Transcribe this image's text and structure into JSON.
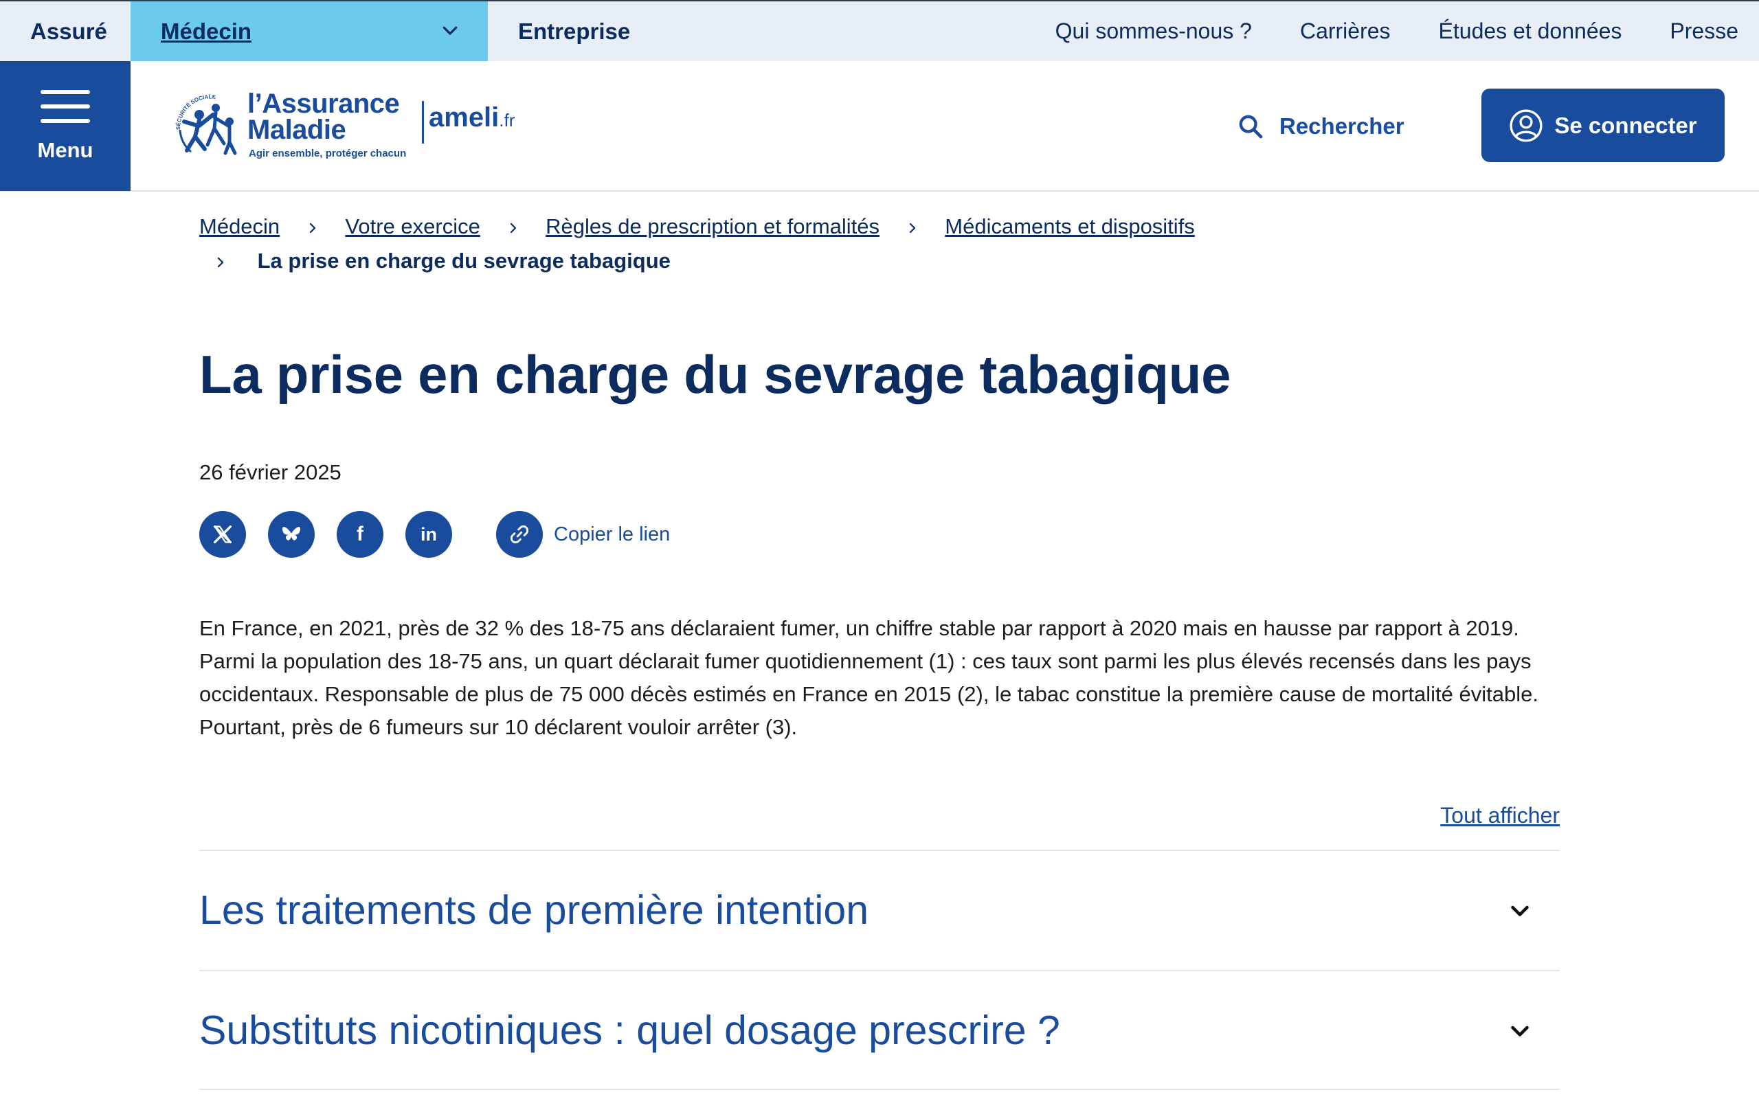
{
  "audience_bar": {
    "assure": "Assuré",
    "medecin": "Médecin",
    "entreprise": "Entreprise"
  },
  "top_nav": {
    "items": [
      "Qui sommes-nous ?",
      "Carrières",
      "Études et données",
      "Presse"
    ]
  },
  "header": {
    "menu_label": "Menu",
    "logo": {
      "line1": "l’Assurance",
      "line2": "Maladie",
      "tagline": "Agir ensemble, protéger chacun",
      "site": "ameli",
      "site_suffix": ".fr",
      "seal_text": "SÉCURITÉ SOCIALE"
    },
    "search_label": "Rechercher",
    "login_label": "Se connecter"
  },
  "breadcrumb": {
    "items": [
      "Médecin",
      "Votre exercice",
      "Règles de prescription et formalités",
      "Médicaments et dispositifs"
    ],
    "current": "La prise en charge du sevrage tabagique"
  },
  "article": {
    "title": "La prise en charge du sevrage tabagique",
    "date": "26 février 2025",
    "share": {
      "icons": [
        "x-icon",
        "bluesky-icon",
        "facebook-icon",
        "linkedin-icon",
        "link-icon"
      ],
      "facebook_glyph": "f",
      "linkedin_glyph": "in",
      "copy_label": "Copier le lien"
    },
    "intro": "En France, en 2021, près de 32 % des 18-75 ans déclaraient fumer, un chiffre stable par rapport à 2020 mais en hausse par rapport à 2019. Parmi la population des 18-75 ans, un quart déclarait fumer quotidiennement  (1) : ces taux sont parmi les plus élevés recensés dans les pays occidentaux. Responsable de plus de 75 000 décès estimés en France en 2015 (2), le tabac constitue la première cause de mortalité évitable. Pourtant, près de 6 fumeurs sur 10 déclarent vouloir arrêter (3)."
  },
  "accordion": {
    "show_all": "Tout afficher",
    "items": [
      {
        "title": "Les traitements de première intention"
      },
      {
        "title": "Substituts nicotiniques : quel dosage prescrire ?"
      }
    ]
  },
  "colors": {
    "brand_blue": "#1a4c9e",
    "navy_text": "#0c2c60",
    "active_tab": "#6ccaee",
    "topbar_bg": "#e8eef6"
  }
}
